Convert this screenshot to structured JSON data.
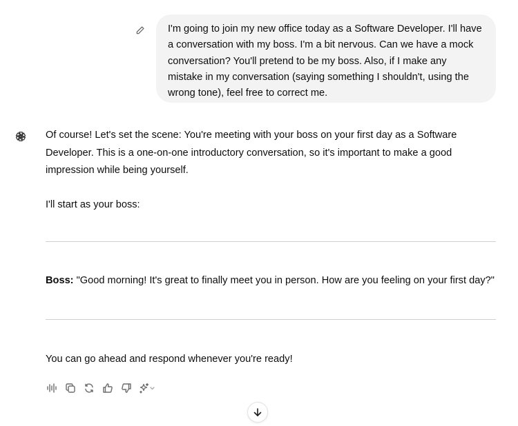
{
  "user_message": {
    "text": "I'm going to join my new office today as a Software Developer. I'll have a conversation with my boss. I'm a bit nervous. Can we have a mock conversation? You'll pretend to be my boss. Also, if I make any mistake in my conversation (saying something I shouldn't, using the wrong tone), feel free to correct me.",
    "edit_icon": "pencil-icon"
  },
  "assistant_message": {
    "avatar_icon": "chatgpt-logo-icon",
    "intro": "Of course! Let's set the scene: You're meeting with your boss on your first day as a Software Developer. This is a one-on-one introductory conversation, so it's important to make a good impression while being yourself.",
    "start": "I'll start as your boss:",
    "boss_label": "Boss:",
    "boss_line": " \"Good morning! It's great to finally meet you in person. How are you feeling on your first day?\"",
    "closing": "You can go ahead and respond whenever you're ready!"
  },
  "actions": {
    "icons": [
      "read-aloud-icon",
      "copy-icon",
      "regenerate-icon",
      "thumbs-up-icon",
      "thumbs-down-icon",
      "sparkle-model-icon"
    ]
  },
  "scroll_down_icon": "arrow-down-icon",
  "colors": {
    "bubble": "#f3f3f3",
    "text": "#0d0d0d",
    "icon": "#6b6b6b",
    "divider": "#cfcfcf"
  }
}
